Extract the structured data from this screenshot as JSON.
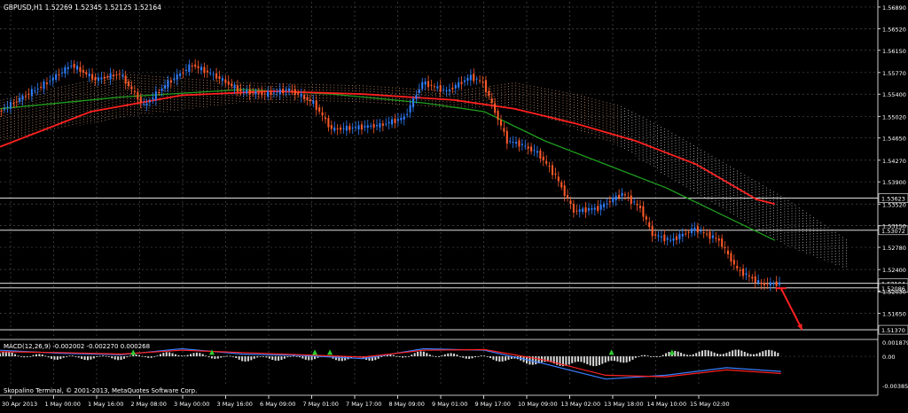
{
  "header": {
    "title": "GBPUSD,H1  1.52269 1.52345 1.52125 1.52164"
  },
  "footer": {
    "copyright": "Skopalino Terminal, © 2001-2013, MetaQuotes Software Corp."
  },
  "colors": {
    "background": "#000000",
    "grid": "#4a4a4a",
    "bull_candle": "#2f7fff",
    "bear_candle": "#ff5a2a",
    "ema_fast": "#1f9e1f",
    "ema_slow": "#ff2020",
    "cloud": "#f0a878",
    "cloud_alt": "#e0e0e0",
    "level": "#ffffff",
    "arrow": "#ff2020",
    "macd_line": "#3a7fff",
    "signal_line": "#ff2020",
    "hist": "#d8d8d8",
    "up_arrow": "#2ecc2e",
    "axis_text": "#ffffff"
  },
  "chart_data": [
    {
      "type": "line",
      "subtype": "candlestick",
      "title": "GBPUSD,H1  1.52269 1.52345 1.52125 1.52164",
      "y_ticks": [
        1.5689,
        1.5652,
        1.5615,
        1.5577,
        1.554,
        1.5502,
        1.5465,
        1.5427,
        1.539,
        1.5352,
        1.5315,
        1.5278,
        1.524,
        1.5203,
        1.5165
      ],
      "y_tick_labels": [
        "1.56890",
        "1.56520",
        "1.56150",
        "1.55770",
        "1.55400",
        "1.55020",
        "1.54650",
        "1.54270",
        "1.53900",
        "1.53520",
        "1.53150",
        "1.52780",
        "1.52400",
        "1.52030",
        "1.51650"
      ],
      "x_tick_labels": [
        "30 Apr 2013",
        "1 May 00:00",
        "1 May 16:00",
        "2 May 08:00",
        "3 May 00:00",
        "3 May 16:00",
        "6 May 09:00",
        "7 May 01:00",
        "7 May 17:00",
        "8 May 09:00",
        "9 May 01:00",
        "9 May 17:00",
        "10 May 09:00",
        "13 May 02:00",
        "13 May 18:00",
        "14 May 10:00",
        "15 May 02:00"
      ],
      "ylim": [
        1.5125,
        1.5698
      ],
      "horizontal_levels": [
        {
          "value": 1.53623,
          "label": "1.53623"
        },
        {
          "value": 1.53072,
          "label": "1.53072"
        },
        {
          "value": 1.52164,
          "label": "1.52164"
        },
        {
          "value": 1.52086,
          "label": "1.52086"
        },
        {
          "value": 1.5137,
          "label": "1.51370"
        }
      ],
      "price_path": [
        [
          0,
          1.551
        ],
        [
          8,
          1.5535
        ],
        [
          16,
          1.556
        ],
        [
          24,
          1.559
        ],
        [
          32,
          1.5565
        ],
        [
          40,
          1.5575
        ],
        [
          48,
          1.552
        ],
        [
          56,
          1.556
        ],
        [
          64,
          1.559
        ],
        [
          72,
          1.557
        ],
        [
          80,
          1.5545
        ],
        [
          88,
          1.554
        ],
        [
          96,
          1.5548
        ],
        [
          104,
          1.5525
        ],
        [
          110,
          1.548
        ],
        [
          118,
          1.5483
        ],
        [
          126,
          1.5487
        ],
        [
          134,
          1.55
        ],
        [
          140,
          1.556
        ],
        [
          148,
          1.5545
        ],
        [
          156,
          1.557
        ],
        [
          160,
          1.556
        ],
        [
          164,
          1.551
        ],
        [
          168,
          1.546
        ],
        [
          172,
          1.5455
        ],
        [
          178,
          1.544
        ],
        [
          184,
          1.54
        ],
        [
          190,
          1.534
        ],
        [
          198,
          1.5345
        ],
        [
          206,
          1.537
        ],
        [
          212,
          1.5345
        ],
        [
          216,
          1.53
        ],
        [
          222,
          1.529
        ],
        [
          230,
          1.531
        ],
        [
          238,
          1.529
        ],
        [
          244,
          1.524
        ],
        [
          252,
          1.5215
        ],
        [
          258,
          1.5216
        ]
      ],
      "ema_fast": [
        [
          0,
          1.5515
        ],
        [
          40,
          1.5535
        ],
        [
          80,
          1.5548
        ],
        [
          110,
          1.554
        ],
        [
          140,
          1.5525
        ],
        [
          160,
          1.551
        ],
        [
          180,
          1.546
        ],
        [
          200,
          1.542
        ],
        [
          220,
          1.538
        ],
        [
          240,
          1.533
        ],
        [
          256,
          1.529
        ]
      ],
      "ema_slow": [
        [
          0,
          1.545
        ],
        [
          30,
          1.551
        ],
        [
          60,
          1.5538
        ],
        [
          90,
          1.5545
        ],
        [
          120,
          1.554
        ],
        [
          150,
          1.553
        ],
        [
          170,
          1.5515
        ],
        [
          190,
          1.549
        ],
        [
          210,
          1.546
        ],
        [
          230,
          1.542
        ],
        [
          250,
          1.536
        ],
        [
          256,
          1.5352
        ]
      ],
      "cloud_upper": [
        [
          0,
          1.553
        ],
        [
          40,
          1.5575
        ],
        [
          80,
          1.556
        ],
        [
          120,
          1.5555
        ],
        [
          150,
          1.5545
        ],
        [
          170,
          1.556
        ],
        [
          190,
          1.554
        ],
        [
          205,
          1.552
        ],
        [
          220,
          1.548
        ],
        [
          240,
          1.542
        ],
        [
          260,
          1.536
        ],
        [
          280,
          1.529
        ]
      ],
      "cloud_lower": [
        [
          0,
          1.546
        ],
        [
          40,
          1.55
        ],
        [
          80,
          1.5525
        ],
        [
          120,
          1.5525
        ],
        [
          150,
          1.5515
        ],
        [
          170,
          1.552
        ],
        [
          190,
          1.548
        ],
        [
          205,
          1.545
        ],
        [
          220,
          1.54
        ],
        [
          240,
          1.534
        ],
        [
          260,
          1.528
        ],
        [
          280,
          1.524
        ]
      ],
      "forecast_arrow": {
        "from": [
          258,
          1.5208
        ],
        "to": [
          265,
          1.5137
        ]
      }
    },
    {
      "type": "line",
      "subtype": "macd",
      "legend": "MACD(12,26,9) -0.002002 -0.002270 0.000268",
      "y_tick_labels": [
        "0.001879",
        "0.00",
        "-0.003856"
      ],
      "ylim": [
        -0.003856,
        0.001879
      ],
      "macd": [
        [
          0,
          0.0008
        ],
        [
          20,
          0.0004
        ],
        [
          40,
          0.0002
        ],
        [
          60,
          0.001
        ],
        [
          80,
          0.0003
        ],
        [
          100,
          0.0001
        ],
        [
          120,
          -0.0003
        ],
        [
          140,
          0.001
        ],
        [
          160,
          0.0008
        ],
        [
          180,
          -0.001
        ],
        [
          200,
          -0.003
        ],
        [
          220,
          -0.0025
        ],
        [
          240,
          -0.0015
        ],
        [
          258,
          -0.002
        ]
      ],
      "signal": [
        [
          0,
          0.0006
        ],
        [
          20,
          0.0005
        ],
        [
          40,
          0.0003
        ],
        [
          60,
          0.0008
        ],
        [
          80,
          0.0005
        ],
        [
          100,
          0.0002
        ],
        [
          120,
          -0.0001
        ],
        [
          140,
          0.0008
        ],
        [
          160,
          0.0009
        ],
        [
          180,
          -0.0005
        ],
        [
          200,
          -0.0025
        ],
        [
          220,
          -0.0027
        ],
        [
          240,
          -0.0018
        ],
        [
          258,
          -0.00227
        ]
      ]
    }
  ]
}
